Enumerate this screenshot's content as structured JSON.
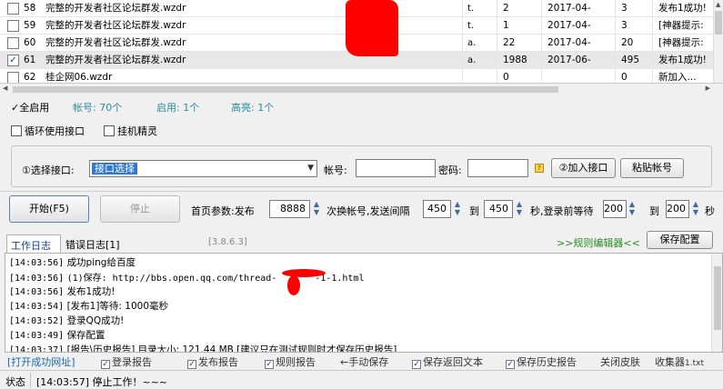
{
  "accounts": [
    {
      "id": "58",
      "name": "完整的开发者社区论坛群发.wzdr",
      "t": "t.",
      "n1": "2",
      "date": "2017-04-",
      "n2": "3",
      "status": "发布1成功!",
      "checked": false
    },
    {
      "id": "59",
      "name": "完整的开发者社区论坛群发.wzdr",
      "t": "t.",
      "n1": "1",
      "date": "2017-04-",
      "n2": "3",
      "status": "[神器提示:",
      "checked": false
    },
    {
      "id": "60",
      "name": "完整的开发者社区论坛群发.wzdr",
      "t": "a.",
      "n1": "22",
      "date": "2017-04-",
      "n2": "20",
      "status": "[神器提示:",
      "checked": false
    },
    {
      "id": "61",
      "name": "完整的开发者社区论坛群发.wzdr",
      "t": "a.",
      "n1": "1988",
      "date": "2017-06-",
      "n2": "495",
      "status": "发布1成功!",
      "checked": true
    },
    {
      "id": "62",
      "name": "桂企网06.wzdr",
      "t": "",
      "n1": "0",
      "date": "",
      "n2": "0",
      "status": "新加入...",
      "checked": false
    }
  ],
  "stats": {
    "enable_all": "全启用",
    "accounts": "帐号: 70个",
    "enabled": "启用: 1个",
    "highlighted": "高亮: 1个"
  },
  "options": {
    "loop": "循环使用接口",
    "sprite": "挂机精灵"
  },
  "interface": {
    "select_label": "①选择接口:",
    "select_value": "接口选择",
    "account_label": "帐号:",
    "password_label": "密码:",
    "add_button": "②加入接口",
    "paste_button": "粘贴帐号"
  },
  "controls": {
    "start": "开始(F5)",
    "stop": "停止",
    "home_param": "首页参数:发布",
    "home_value": "8888",
    "switch_label": "次换帐号,发送间隔",
    "interval_from": "450",
    "to1": "到",
    "interval_to": "450",
    "wait_label": "秒,登录前等待",
    "wait_from": "200",
    "to2": "到",
    "wait_to": "200",
    "sec": "秒"
  },
  "tabs": {
    "work_log": "工作日志",
    "error_log": "错误日志[1]",
    "version": "[3.8.6.3]",
    "rule_editor": ">>规则编辑器<<",
    "save_config": "保存配置"
  },
  "log": [
    {
      "time": "[14:03:56]",
      "text": "成功ping给百度"
    },
    {
      "time": "[14:03:56]",
      "text": "(1)保存: http://bbs.open.qq.com/thread-",
      "tail": "-1-1.html"
    },
    {
      "time": "[14:03:56]",
      "text": "发布1成功!"
    },
    {
      "time": "[14:03:54]",
      "text": "[发布1]等待: 1000毫秒"
    },
    {
      "time": "[14:03:52]",
      "text": "登录QQ成功!"
    },
    {
      "time": "[14:03:49]",
      "text": "保存配置"
    },
    {
      "time": "[14:03:37]",
      "text": "[报告\\历史报告] 目录大小: 121.44 MB [建议只在测试规则时才保存历史报告]"
    }
  ],
  "toolbar": {
    "open_url": "[打开成功网址]",
    "login_report": "登录报告",
    "post_report": "发布报告",
    "rule_report": "规则报告",
    "manual_save": "←手动保存",
    "save_return": "保存返回文本",
    "save_history": "保存历史报告",
    "close_skin": "关闭皮肤",
    "collector": "收集器",
    "collector_file": "1.txt"
  },
  "statusbar": {
    "label": "状态",
    "message": "[14:03:57] 停止工作！~~~"
  }
}
